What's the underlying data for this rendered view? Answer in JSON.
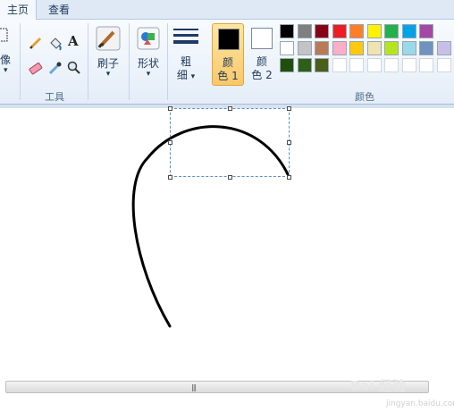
{
  "tabs": [
    {
      "label": "主页",
      "active": true
    },
    {
      "label": "查看",
      "active": false
    }
  ],
  "ribbon": {
    "image_group_label": "像",
    "tools_group_label": "工具",
    "brushes_label": "刷子",
    "shapes_label": "形状",
    "size_label_top": "粗",
    "size_label_bottom": "细",
    "color1_label_top": "颜",
    "color1_label_bottom": "色 1",
    "color2_label_top": "颜",
    "color2_label_bottom": "色 2",
    "colors_group_label": "颜色",
    "dropdown_arrow": "▾",
    "color1_value": "#000000",
    "color2_value": "#ffffff",
    "text_tool_glyph": "A"
  },
  "palette": [
    [
      "#000000",
      "#7f7f7f",
      "#880015",
      "#ed1c24",
      "#ff7f27",
      "#fff200",
      "#22b14c",
      "#00a2e8",
      "#a349a4"
    ],
    [
      "#ffffff",
      "#c3c3c3",
      "#b97a57",
      "#ffaec9",
      "#ffc90e",
      "#efe4b0",
      "#b5e61d",
      "#99d9ea",
      "#7092be",
      "#c8bfe7"
    ],
    [
      "#1f4e0f",
      "#2f5f16",
      "#4b5e1a",
      "#ffffff",
      "#ffffff",
      "#ffffff",
      "#ffffff",
      "#ffffff",
      "#ffffff",
      "#ffffff"
    ]
  ],
  "scrollbar": {
    "grip": "|||"
  },
  "watermark": {
    "text": "Bai 经验",
    "sub": "jingyan.baidu.com"
  }
}
